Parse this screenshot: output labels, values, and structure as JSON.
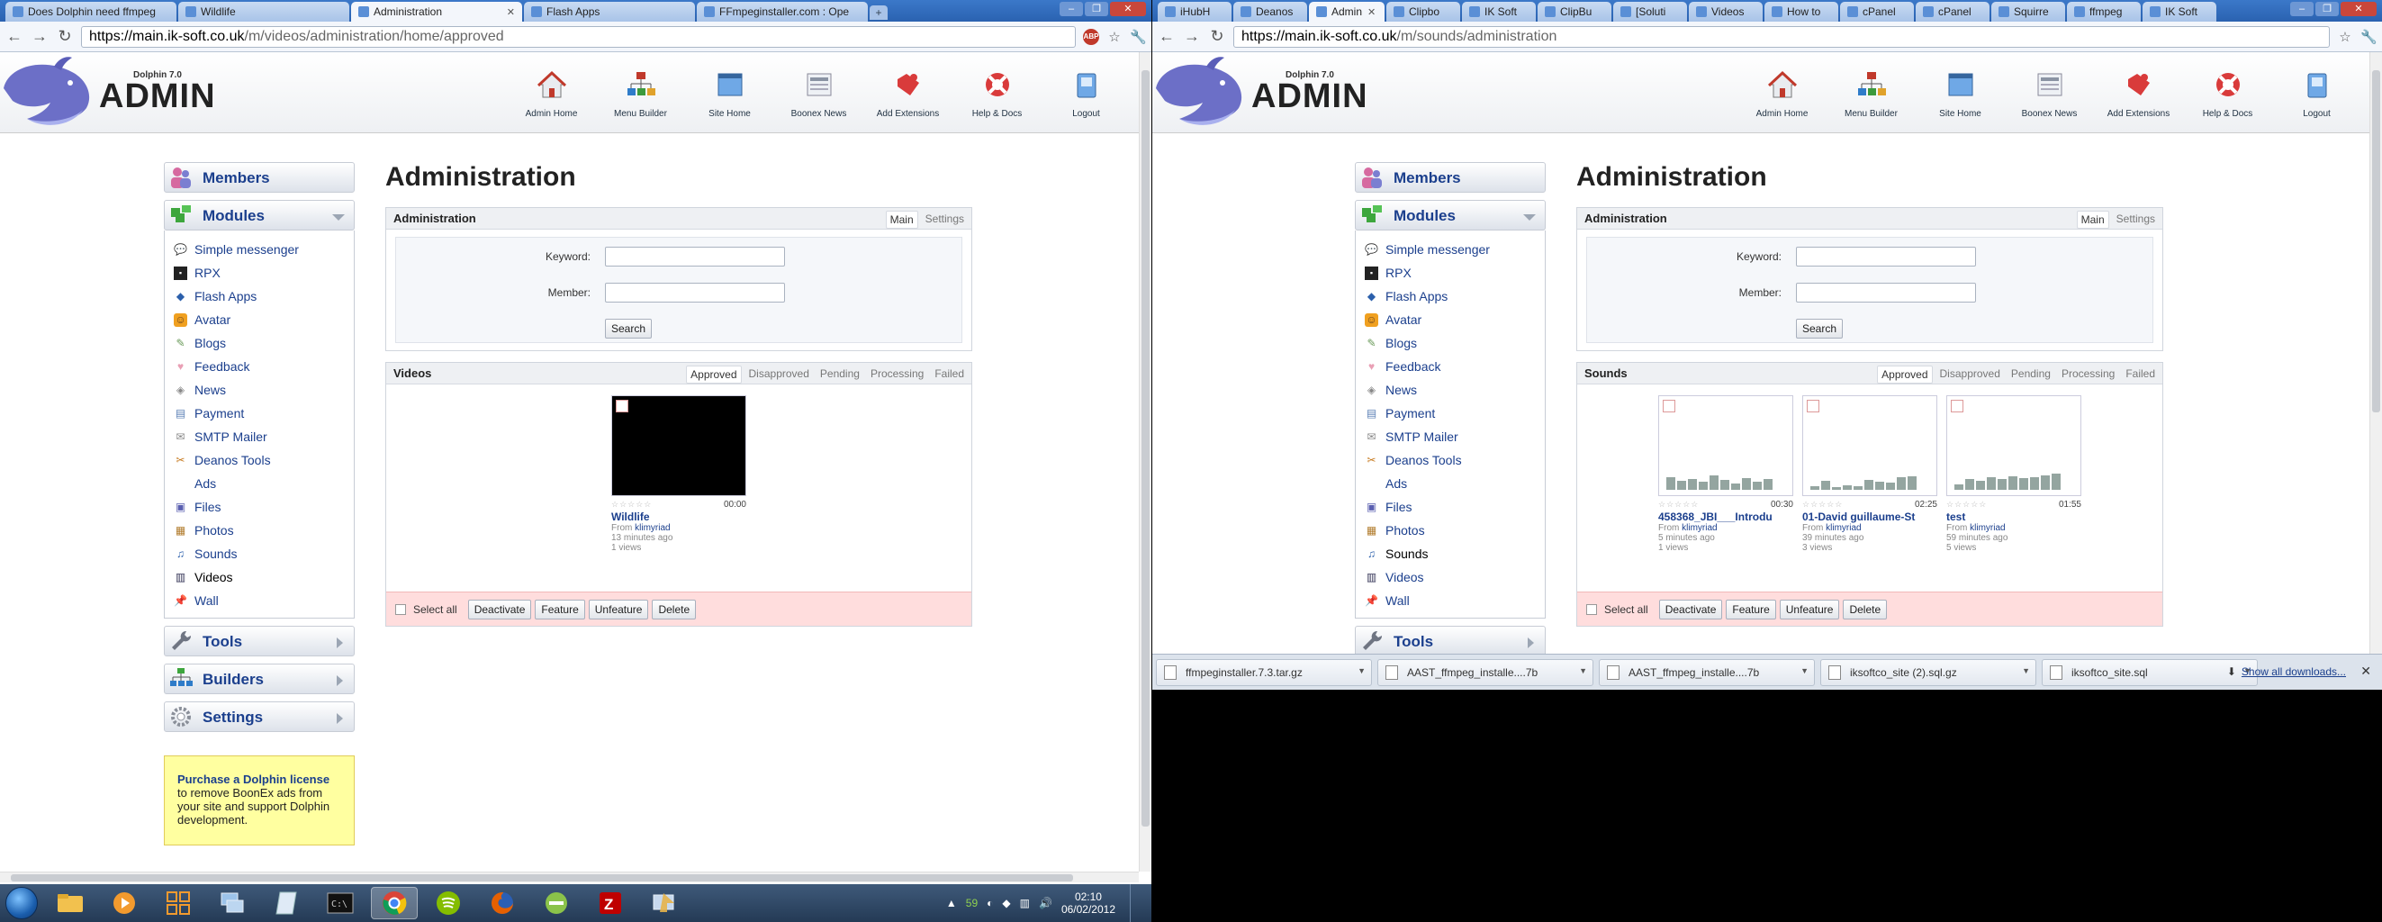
{
  "left_window": {
    "tabs": [
      {
        "label": "Does Dolphin need ffmpeg"
      },
      {
        "label": "Wildlife"
      },
      {
        "label": "Administration"
      },
      {
        "label": "Flash Apps"
      },
      {
        "label": "FFmpeginstaller.com : Ope"
      }
    ],
    "url_host": "https://main.ik-soft.co.uk",
    "url_path": "/m/videos/administration/home/approved"
  },
  "right_window": {
    "tabs": [
      {
        "label": "iHubH"
      },
      {
        "label": "Deanos"
      },
      {
        "label": "Admin"
      },
      {
        "label": "Clipbo"
      },
      {
        "label": "IK Soft"
      },
      {
        "label": "ClipBu"
      },
      {
        "label": "[Soluti"
      },
      {
        "label": "Videos"
      },
      {
        "label": "How to"
      },
      {
        "label": "cPanel"
      },
      {
        "label": "cPanel"
      },
      {
        "label": "Squirre"
      },
      {
        "label": "ffmpeg"
      },
      {
        "label": "IK Soft"
      }
    ],
    "url_host": "https://main.ik-soft.co.uk",
    "url_path": "/m/sounds/administration"
  },
  "header": {
    "logo_small": "Dolphin 7.0",
    "logo_big": "ADMIN",
    "nav": [
      {
        "label": "Admin Home",
        "icon": "house-icon"
      },
      {
        "label": "Menu Builder",
        "icon": "sitemap-icon"
      },
      {
        "label": "Site Home",
        "icon": "window-icon"
      },
      {
        "label": "Boonex News",
        "icon": "newspaper-icon"
      },
      {
        "label": "Add Extensions",
        "icon": "puzzle-icon"
      },
      {
        "label": "Help & Docs",
        "icon": "lifebuoy-icon"
      },
      {
        "label": "Logout",
        "icon": "logout-icon"
      }
    ]
  },
  "sidebar": {
    "members": "Members",
    "modules": "Modules",
    "items": [
      {
        "label": "Simple messenger"
      },
      {
        "label": "RPX"
      },
      {
        "label": "Flash Apps"
      },
      {
        "label": "Avatar"
      },
      {
        "label": "Blogs"
      },
      {
        "label": "Feedback"
      },
      {
        "label": "News"
      },
      {
        "label": "Payment"
      },
      {
        "label": "SMTP Mailer"
      },
      {
        "label": "Deanos Tools"
      },
      {
        "label": "Ads"
      },
      {
        "label": "Files"
      },
      {
        "label": "Photos"
      },
      {
        "label": "Sounds"
      },
      {
        "label": "Videos"
      },
      {
        "label": "Wall"
      }
    ],
    "tools": "Tools",
    "builders": "Builders",
    "settings": "Settings",
    "promo_link": "Purchase a Dolphin license",
    "promo_text": "to remove BoonEx ads from your site and support Dolphin development."
  },
  "main": {
    "title": "Administration",
    "search_box_title": "Administration",
    "search_tabs": [
      "Main",
      "Settings"
    ],
    "keyword_label": "Keyword:",
    "member_label": "Member:",
    "search_button": "Search",
    "status_tabs": [
      "Approved",
      "Disapproved",
      "Pending",
      "Processing",
      "Failed"
    ],
    "select_all": "Select all",
    "actions": [
      "Deactivate",
      "Feature",
      "Unfeature",
      "Delete"
    ]
  },
  "videos_box": {
    "title": "Videos",
    "items": [
      {
        "title": "Wildlife",
        "duration": "00:00",
        "from_label": "From",
        "author": "klimyriad",
        "ago": "13 minutes ago",
        "views": "1 views"
      }
    ]
  },
  "sounds_box": {
    "title": "Sounds",
    "items": [
      {
        "title": "458368_JBI___Introdu",
        "duration": "00:30",
        "from_label": "From",
        "author": "klimyriad",
        "ago": "5 minutes ago",
        "views": "1 views"
      },
      {
        "title": "01-David guillaume-St",
        "duration": "02:25",
        "from_label": "From",
        "author": "klimyriad",
        "ago": "39 minutes ago",
        "views": "3 views"
      },
      {
        "title": "test",
        "duration": "01:55",
        "from_label": "From",
        "author": "klimyriad",
        "ago": "59 minutes ago",
        "views": "5 views"
      }
    ]
  },
  "downloads": {
    "items": [
      {
        "name": "ffmpeginstaller.7.3.tar.gz"
      },
      {
        "name": "AAST_ffmpeg_installe....7b"
      },
      {
        "name": "AAST_ffmpeg_installe....7b"
      },
      {
        "name": "iksoftco_site (2).sql.gz"
      },
      {
        "name": "iksoftco_site.sql"
      }
    ],
    "show_all": "Show all downloads..."
  },
  "taskbar": {
    "apps": [
      "explorer-icon",
      "media-player-icon",
      "app-grid-icon",
      "network-icon",
      "notepad-icon",
      "terminal-icon",
      "chrome-icon",
      "spotify-icon",
      "firefox-icon",
      "app-icon",
      "filezilla-icon",
      "remote-icon"
    ],
    "tray_count": "59",
    "time": "02:10",
    "date": "06/02/2012"
  }
}
